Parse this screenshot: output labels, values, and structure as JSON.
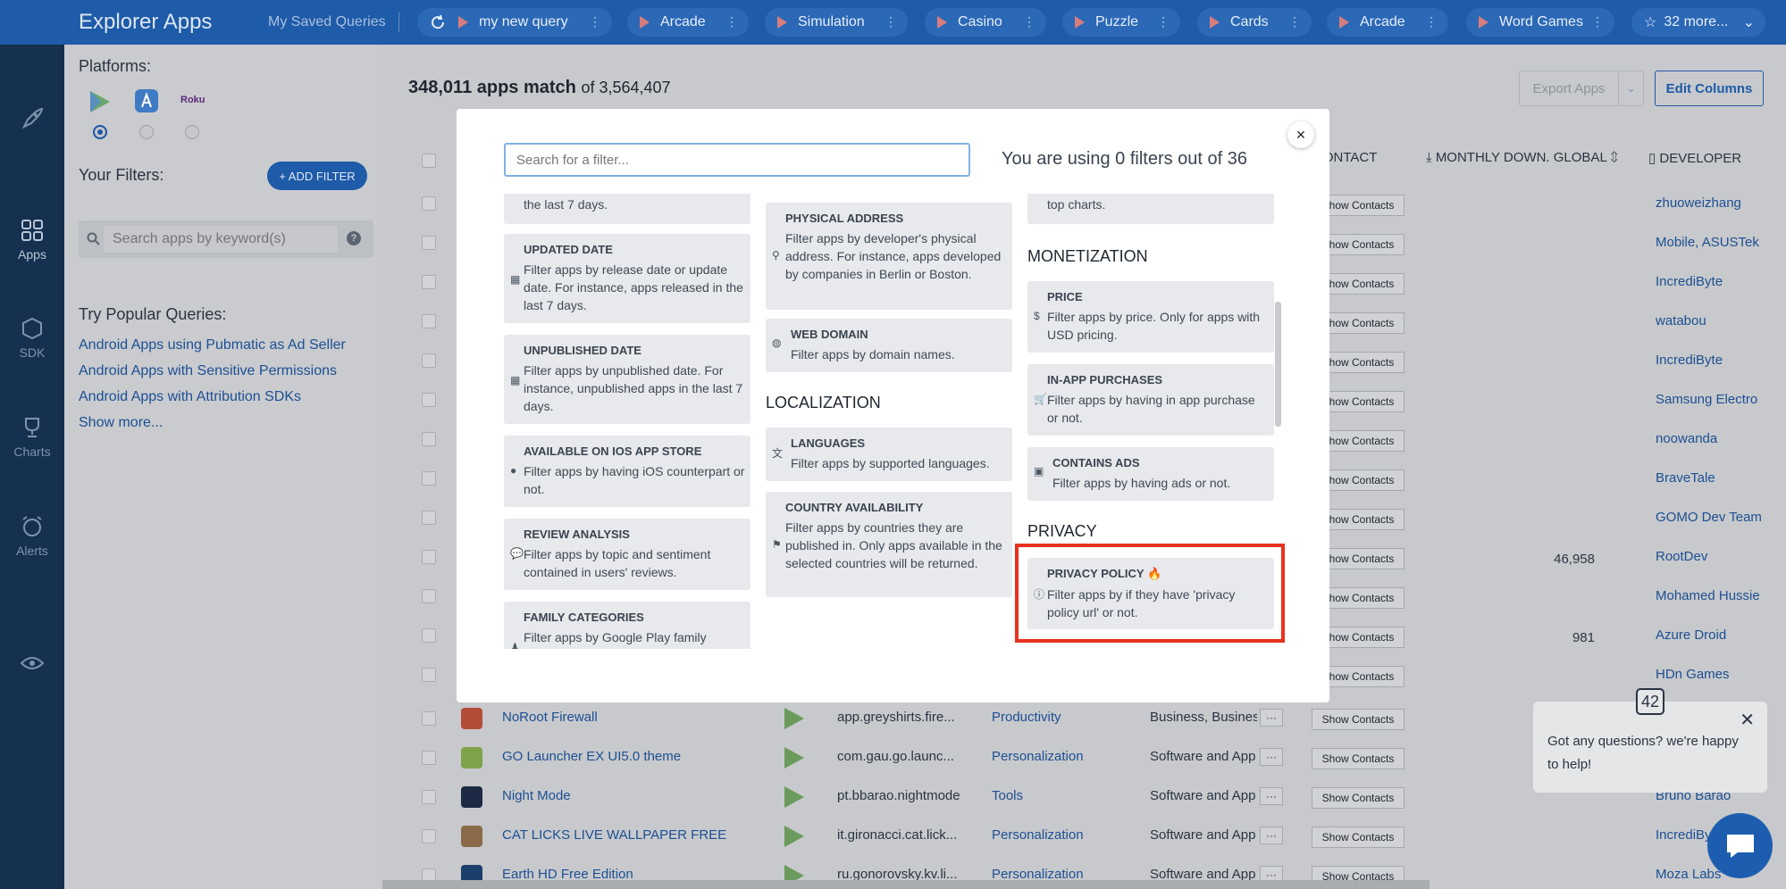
{
  "app": {
    "brand": "Explorer Apps",
    "saved_queries": "My Saved Queries"
  },
  "query_tabs": [
    {
      "label": "my new query"
    },
    {
      "label": "Arcade"
    },
    {
      "label": "Simulation"
    },
    {
      "label": "Casino"
    },
    {
      "label": "Puzzle"
    },
    {
      "label": "Cards"
    },
    {
      "label": "Arcade"
    },
    {
      "label": "Word Games"
    }
  ],
  "more_tab": "32 more...",
  "leftnav": [
    {
      "label": "Apps"
    },
    {
      "label": "SDK"
    },
    {
      "label": "Charts"
    },
    {
      "label": "Alerts"
    }
  ],
  "sidebar": {
    "platforms_label": "Platforms:",
    "roku": "Roku",
    "filters_label": "Your Filters:",
    "add_filter": "+ ADD FILTER",
    "search_placeholder": "Search apps by keyword(s)",
    "help": "?",
    "popular_label": "Try Popular Queries:",
    "popular": [
      "Android Apps using Pubmatic as Ad Seller",
      "Android Apps with Sensitive Permissions",
      "Android Apps with Attribution SDKs",
      "Show more..."
    ]
  },
  "main": {
    "match_count": "348,011 apps match",
    "match_total": "of 3,564,407",
    "export": "Export Apps",
    "edit_columns": "Edit Columns",
    "headers": {
      "contact": "CONTACT",
      "monthly": "MONTHLY DOWN. GLOBAL",
      "developer": "DEVELOPER"
    },
    "show_contacts": "Show Contacts",
    "developers": [
      "zhuoweizhang",
      "Mobile, ASUSTek",
      "IncrediByte",
      "watabou",
      "IncrediByte",
      "Samsung Electro",
      "noowanda",
      "BraveTale",
      "GOMO Dev Team",
      "RootDev",
      "Mohamed Hussie",
      "Azure Droid",
      "HDn Games",
      "",
      "Bruno Barão",
      "IncrediBy",
      "Moza Labs"
    ],
    "downloads": {
      "9": "46,958",
      "11": "981"
    },
    "apps": [
      {
        "name": "NoRoot Firewall",
        "package": "app.greyshirts.fire...",
        "category": "Productivity",
        "genre": "Business, Busines"
      },
      {
        "name": "GO Launcher EX UI5.0 theme",
        "package": "com.gau.go.launc...",
        "category": "Personalization",
        "genre": "Software and App"
      },
      {
        "name": "Night Mode",
        "package": "pt.bbarao.nightmode",
        "category": "Tools",
        "genre": "Software and App"
      },
      {
        "name": "CAT LICKS LIVE WALLPAPER FREE",
        "package": "it.gironacci.cat.lick...",
        "category": "Personalization",
        "genre": "Software and App"
      },
      {
        "name": "Earth HD Free Edition",
        "package": "ru.gonorovsky.kv.li...",
        "category": "Personalization",
        "genre": "Software and App"
      }
    ]
  },
  "modal": {
    "search_placeholder": "Search for a filter...",
    "usage": "You are using 0 filters out of 36",
    "close": "×",
    "col1": [
      {
        "partial": "the last 7 days."
      },
      {
        "title": "UPDATED DATE",
        "desc": "Filter apps by release date or update date. For instance, apps released in the last 7 days."
      },
      {
        "title": "UNPUBLISHED DATE",
        "desc": "Filter apps by unpublished date. For instance, unpublished apps in the last 7 days."
      },
      {
        "title": "AVAILABLE ON IOS APP STORE",
        "desc": "Filter apps by having iOS counterpart or not."
      },
      {
        "title": "REVIEW ANALYSIS",
        "desc": "Filter apps by topic and sentiment contained in users' reviews."
      },
      {
        "title": "FAMILY CATEGORIES",
        "desc": "Filter apps by Google Play family"
      }
    ],
    "col2": [
      {
        "title": "PHYSICAL ADDRESS",
        "desc": "Filter apps by developer's physical address. For instance, apps developed by companies in Berlin or Boston."
      },
      {
        "title": "WEB DOMAIN",
        "desc": "Filter apps by domain names."
      },
      {
        "section": "LOCALIZATION"
      },
      {
        "title": "LANGUAGES",
        "desc": "Filter apps by supported languages."
      },
      {
        "title": "COUNTRY AVAILABILITY",
        "desc": "Filter apps by countries they are published in. Only apps available in the selected countries will be returned."
      }
    ],
    "col3": [
      {
        "partial": "top charts."
      },
      {
        "section": "MONETIZATION"
      },
      {
        "title": "PRICE",
        "desc": "Filter apps by price. Only for apps with USD pricing."
      },
      {
        "title": "IN-APP PURCHASES",
        "desc": "Filter apps by having in app purchase or not."
      },
      {
        "title": "CONTAINS ADS",
        "desc": "Filter apps by having ads or not."
      },
      {
        "section": "PRIVACY"
      },
      {
        "title": "PRIVACY POLICY",
        "desc": "Filter apps by if they have 'privacy policy url' or not."
      }
    ]
  },
  "chat": {
    "badge": "42",
    "message": "Got any questions? we're happy to help!"
  },
  "colors": {
    "brand": "#1e5ba8",
    "highlight": "#e8321e",
    "nav": "#16304f"
  }
}
